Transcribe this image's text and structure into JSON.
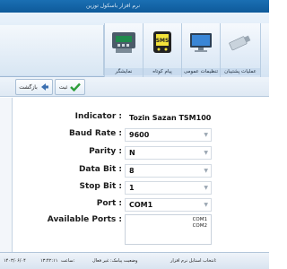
{
  "window": {
    "title": "نرم افزار باسکول توزین"
  },
  "ribbon": {
    "buttons": [
      {
        "label": "نمایشگر",
        "icon": "scale-display-icon"
      },
      {
        "label": "پیام کوتاه",
        "icon": "sms-phone-icon"
      },
      {
        "label": "تنظیمات عمومی",
        "icon": "monitor-icon"
      },
      {
        "label": "عملیات پشتیبان",
        "icon": "usb-drive-icon"
      }
    ]
  },
  "toolbar": {
    "back_label": "بازگشت",
    "save_label": "ثبت"
  },
  "form": {
    "indicator": {
      "label": "Indicator :",
      "value": "Tozin Sazan TSM100"
    },
    "baud_rate": {
      "label": "Baud Rate :",
      "value": "9600"
    },
    "parity": {
      "label": "Parity :",
      "value": "N"
    },
    "data_bit": {
      "label": "Data Bit :",
      "value": "8"
    },
    "stop_bit": {
      "label": "Stop Bit :",
      "value": "1"
    },
    "port": {
      "label": "Port :",
      "value": "COM1"
    },
    "available_ports": {
      "label": "Available Ports :",
      "items": [
        "COM1",
        "COM2"
      ]
    }
  },
  "status": {
    "date": "۱۴۰۳/۰۶/۰۴",
    "time_label": "ساعت:",
    "time": "۱۳:۴۲:۱۱",
    "sms_status": "وضعیت پیامک: غیر فعال",
    "select_text": "انتخاب استایل نرم افزار:"
  }
}
